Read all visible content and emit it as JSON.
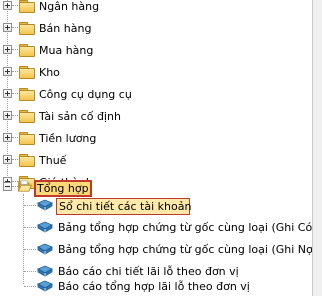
{
  "tree": {
    "folders": [
      {
        "label": "Ngân hàng"
      },
      {
        "label": "Bán hàng"
      },
      {
        "label": "Mua hàng"
      },
      {
        "label": "Kho"
      },
      {
        "label": "Công cụ dụng cụ"
      },
      {
        "label": "Tài sản cố định"
      },
      {
        "label": "Tiền lương"
      },
      {
        "label": "Thuế"
      },
      {
        "label": "Giá thành"
      }
    ],
    "open_folder": {
      "label": "Tổng hợp"
    },
    "reports": [
      {
        "label": "Sổ chi tiết các tài khoản",
        "selected": true
      },
      {
        "label": "Bảng tổng hợp chứng từ gốc cùng loại (Ghi Có T"
      },
      {
        "label": "Bảng tổng hợp chứng từ gốc cùng loại (Ghi Nợ T"
      },
      {
        "label": "Báo cáo chi tiết lãi lỗ theo đơn vị"
      },
      {
        "label": "Báo cáo tổng hợp lãi lỗ theo đơn vị"
      }
    ]
  },
  "colors": {
    "folder": "#f3c451",
    "book": "#2f78b5",
    "selection_border": "#c0392b",
    "selection_fill": "#ffe9a8"
  }
}
